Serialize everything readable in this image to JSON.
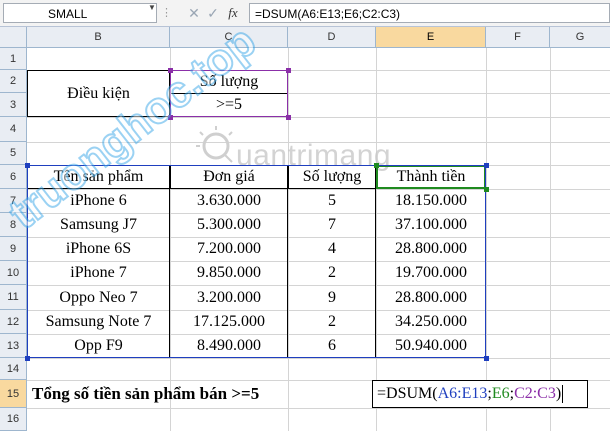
{
  "formula_bar": {
    "name_box": "SMALL",
    "cancel_icon": "✕",
    "enter_icon": "✓",
    "fx_label": "fx",
    "formula": "=DSUM(A6:E13;E6;C2:C3)"
  },
  "columns": [
    "B",
    "C",
    "D",
    "E",
    "F",
    "G"
  ],
  "rows": [
    "1",
    "2",
    "3",
    "4",
    "5",
    "6",
    "7",
    "8",
    "9",
    "10",
    "11",
    "12",
    "13",
    "14",
    "15",
    "16"
  ],
  "criteria": {
    "label": "Điều kiện",
    "header": "Số lượng",
    "value": ">=5"
  },
  "table": {
    "headers": [
      "Tên sản phẩm",
      "Đơn giá",
      "Số lượng",
      "Thành tiền"
    ],
    "rows": [
      [
        "iPhone 6",
        "3.630.000",
        "5",
        "18.150.000"
      ],
      [
        "Samsung J7",
        "5.300.000",
        "7",
        "37.100.000"
      ],
      [
        "iPhone 6S",
        "7.200.000",
        "4",
        "28.800.000"
      ],
      [
        "iPhone 7",
        "9.850.000",
        "2",
        "19.700.000"
      ],
      [
        "Oppo Neo 7",
        "3.200.000",
        "9",
        "28.800.000"
      ],
      [
        "Samsung Note 7",
        "17.125.000",
        "2",
        "34.250.000"
      ],
      [
        "Opp F9",
        "8.490.000",
        "6",
        "50.940.000"
      ]
    ]
  },
  "total": {
    "label": "Tổng số tiền sản phẩm bán >=5",
    "formula_parts": [
      "=DSUM(",
      "A6:E13",
      ";",
      "E6",
      ";",
      "C2:C3",
      ")"
    ]
  },
  "colors": {
    "ref_table": "#1f3fbf",
    "ref_field": "#1f8a1f",
    "ref_criteria": "#8b2fa8",
    "selected_header": "#f9d99f"
  },
  "watermarks": {
    "quantrimang": "uantrimang",
    "diagonal": "truonghoc.top"
  }
}
